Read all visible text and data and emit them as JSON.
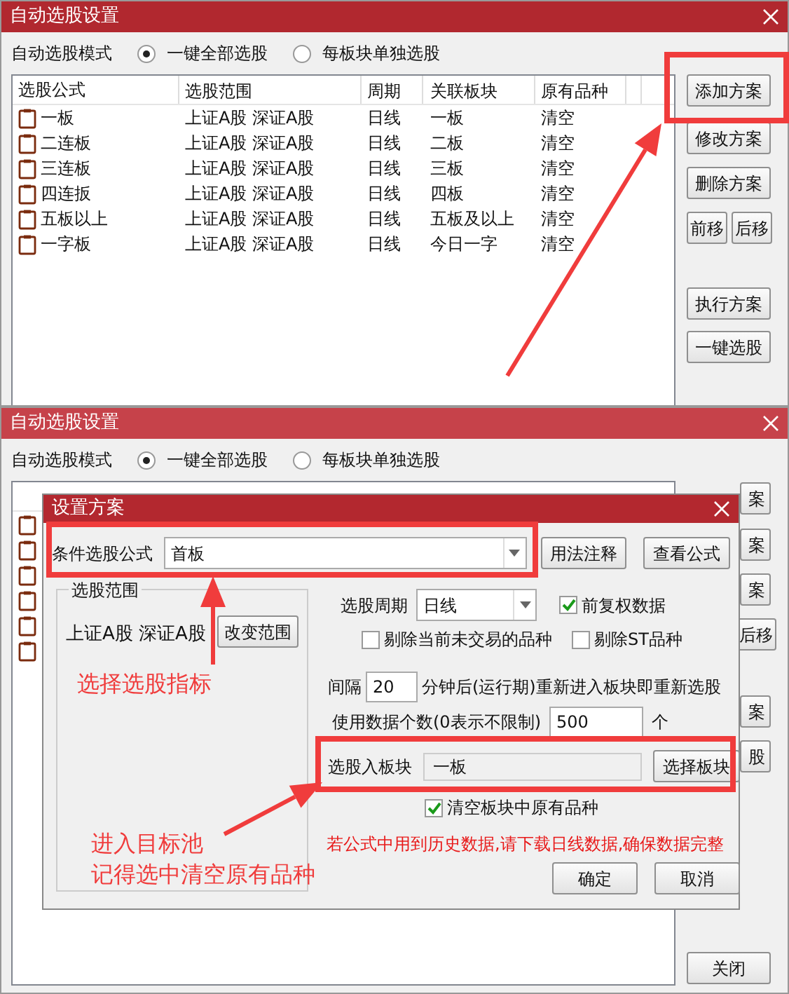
{
  "main_window": {
    "title": "自动选股设置",
    "mode_label": "自动选股模式",
    "modes": [
      {
        "label": "一键全部选股",
        "selected": true
      },
      {
        "label": "每板块单独选股",
        "selected": false
      }
    ],
    "columns": [
      "选股公式",
      "选股范围",
      "周期",
      "关联板块",
      "原有品种"
    ],
    "rows": [
      {
        "formula": "一板",
        "scope": "上证A股 深证A股",
        "period": "日线",
        "sector": "一板",
        "original": "清空"
      },
      {
        "formula": "二连板",
        "scope": "上证A股 深证A股",
        "period": "日线",
        "sector": "二板",
        "original": "清空"
      },
      {
        "formula": "三连板",
        "scope": "上证A股 深证A股",
        "period": "日线",
        "sector": "三板",
        "original": "清空"
      },
      {
        "formula": "四连扳",
        "scope": "上证A股 深证A股",
        "period": "日线",
        "sector": "四板",
        "original": "清空"
      },
      {
        "formula": "五板以上",
        "scope": "上证A股 深证A股",
        "period": "日线",
        "sector": "五板及以上",
        "original": "清空"
      },
      {
        "formula": "一字板",
        "scope": "上证A股 深证A股",
        "period": "日线",
        "sector": "今日一字",
        "original": "清空"
      }
    ],
    "buttons": [
      {
        "label": "添加方案",
        "kind": "wide"
      },
      {
        "label": "修改方案",
        "kind": "wide"
      },
      {
        "label": "删除方案",
        "kind": "wide"
      },
      {
        "label": "前移",
        "kind": "half"
      },
      {
        "label": "后移",
        "kind": "half"
      },
      {
        "label": "执行方案",
        "kind": "wide"
      },
      {
        "label": "一键选股",
        "kind": "wide"
      }
    ]
  },
  "background_window": {
    "title": "自动选股设置",
    "mode_label": "自动选股模式",
    "modes": [
      {
        "label": "一键全部选股",
        "selected": true
      },
      {
        "label": "每板块单独选股",
        "selected": false
      }
    ],
    "rows": [
      {
        "kind": "item"
      },
      {
        "kind": "item"
      },
      {
        "kind": "item"
      },
      {
        "kind": "item"
      },
      {
        "kind": "item"
      },
      {
        "kind": "item"
      }
    ],
    "buttons": [
      {
        "label": "案",
        "kind": "partial"
      },
      {
        "label": "案",
        "kind": "partial"
      },
      {
        "label": "案",
        "kind": "partial"
      },
      {
        "label": "后移",
        "kind": "half"
      },
      {
        "label": "案",
        "kind": "partial"
      },
      {
        "label": "股",
        "kind": "partial"
      },
      {
        "label": "关闭",
        "kind": "wide"
      }
    ]
  },
  "dialog": {
    "title": "设置方案",
    "formula_label": "条件选股公式",
    "formula_value": "首板",
    "usage_button": "用法注释",
    "view_button": "查看公式",
    "scope_group": {
      "legend": "选股范围",
      "scope_text": "上证A股 深证A股",
      "change_button": "改变范围"
    },
    "period_label": "选股周期",
    "period_value": "日线",
    "checkboxes": [
      {
        "label": "前复权数据",
        "checked": true
      },
      {
        "label": "剔除当前未交易的品种",
        "checked": false
      },
      {
        "label": "剔除ST品种",
        "checked": false
      }
    ],
    "interval_label": "间隔",
    "interval_value": "20",
    "interval_suffix": "分钟后(运行期)重新进入板块即重新选股",
    "count_label": "使用数据个数(0表示不限制)",
    "count_value": "500",
    "count_suffix": "个",
    "target_label": "选股入板块",
    "target_value": "一板",
    "target_button": "选择板块",
    "clear_checkbox": {
      "label": "清空板块中原有品种",
      "checked": true
    },
    "warning": "若公式中用到历史数据,请下载日线数据,确保数据完整",
    "ok_button": "确定",
    "cancel_button": "取消"
  },
  "notes": [
    {
      "lines": [
        "选择选股指标"
      ]
    },
    {
      "lines": [
        "进入目标池",
        "记得选中清空原有品种"
      ]
    }
  ]
}
